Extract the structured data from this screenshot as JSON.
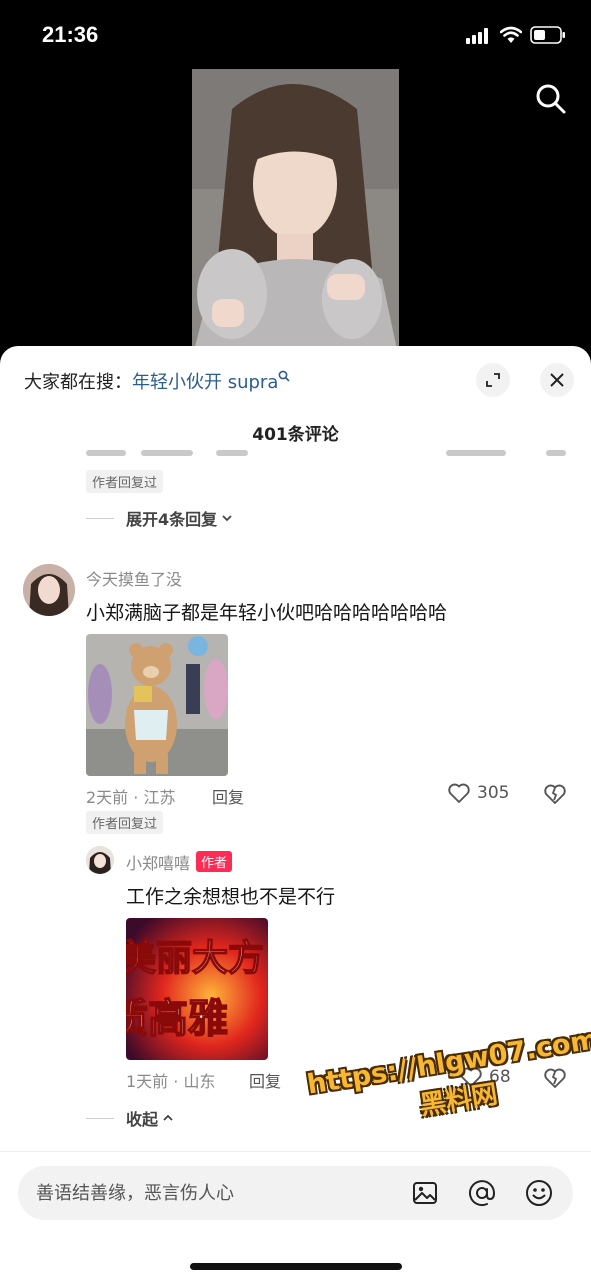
{
  "status_bar": {
    "time": "21:36"
  },
  "sheet": {
    "hot_search_prefix": "大家都在搜：",
    "hot_search_keyword": "年轻小伙开 supra",
    "comment_count": "401条评论"
  },
  "prev_thread": {
    "author_replied": "作者回复过",
    "expand_replies": "展开4条回复"
  },
  "comment": {
    "username": "今天摸鱼了没",
    "text": "小郑满脑子都是年轻小伙吧哈哈哈哈哈哈哈",
    "meta": "2天前 · 江苏",
    "reply": "回复",
    "likes": "305",
    "author_replied": "作者回复过"
  },
  "reply": {
    "username": "小郑嘻嘻",
    "author_tag": "作者",
    "text": "工作之余想想也不是不行",
    "image_text_top": "美丽大方",
    "image_text_bottom": "质高雅",
    "meta": "1天前 · 山东",
    "reply": "回复",
    "likes": "68"
  },
  "collapse": "收起",
  "input": {
    "placeholder": "善语结善缘，恶言伤人心"
  },
  "watermark": {
    "url": "https://hlgw07.com",
    "name": "黑料网"
  },
  "icons": [
    "search-icon",
    "expand-icon",
    "close-icon",
    "chevron-down-icon",
    "chevron-up-icon",
    "heart-icon",
    "broken-heart-icon",
    "image-icon",
    "at-icon",
    "emoji-icon"
  ]
}
